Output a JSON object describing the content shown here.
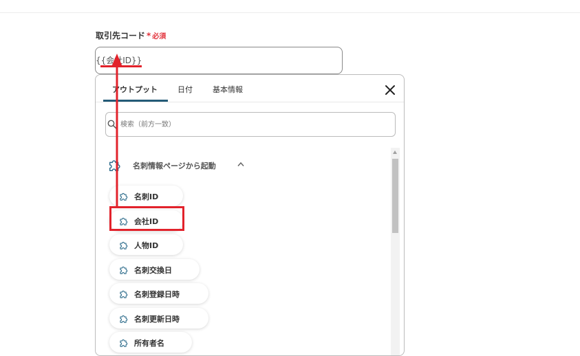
{
  "field": {
    "label": "取引先コード",
    "required_mark": "*",
    "required_text": "必須",
    "value": "{{会社ID}}"
  },
  "picker": {
    "tabs": [
      {
        "label": "アウトプット",
        "active": true
      },
      {
        "label": "日付",
        "active": false
      },
      {
        "label": "基本情報",
        "active": false
      }
    ],
    "search_placeholder": "検索（前方一致）",
    "section": {
      "title": "名刺情報ページから起動",
      "expanded": true,
      "icon": "puzzle-icon"
    },
    "items": [
      {
        "label": "名刺ID",
        "icon": "puzzle-icon"
      },
      {
        "label": "会社ID",
        "icon": "puzzle-icon",
        "highlighted": true
      },
      {
        "label": "人物ID",
        "icon": "puzzle-icon"
      },
      {
        "label": "名刺交換日",
        "icon": "puzzle-icon"
      },
      {
        "label": "名刺登録日時",
        "icon": "puzzle-icon"
      },
      {
        "label": "名刺更新日時",
        "icon": "puzzle-icon"
      },
      {
        "label": "所有者名",
        "icon": "puzzle-icon"
      }
    ]
  },
  "colors": {
    "accent": "#245b78",
    "annotation_red": "#e2222b",
    "required_red": "#e2333c"
  }
}
